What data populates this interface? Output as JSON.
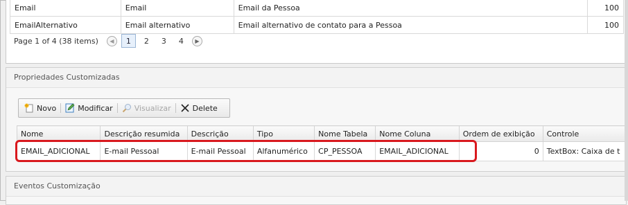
{
  "top_table": {
    "rows": [
      {
        "name": "Email",
        "label": "Email",
        "description": "Email da Pessoa",
        "value": "100"
      },
      {
        "name": "EmailAlternativo",
        "label": "Email alternativo",
        "description": "Email alternativo de contato para a Pessoa",
        "value": "100"
      }
    ]
  },
  "pager": {
    "info": "Page 1 of 4 (38 items)",
    "pages": [
      "1",
      "2",
      "3",
      "4"
    ],
    "current": "1"
  },
  "custom_props": {
    "title": "Propriedades Customizadas",
    "toolbar": {
      "new_label": "Novo",
      "edit_label": "Modificar",
      "view_label": "Visualizar",
      "delete_label": "Delete"
    },
    "columns": [
      "Nome",
      "Descrição resumida",
      "Descrição",
      "Tipo",
      "Nome Tabela",
      "Nome Coluna",
      "Ordem de exibição",
      "Controle"
    ],
    "rows": [
      {
        "nome": "EMAIL_ADICIONAL",
        "desc_resumida": "E-mail Pessoal",
        "descricao": "E-mail Pessoal",
        "tipo": "Alfanumérico",
        "tabela": "CP_PESSOA",
        "coluna": "EMAIL_ADICIONAL",
        "ordem": "0",
        "controle": "TextBox: Caixa de t"
      }
    ]
  },
  "events": {
    "title": "Eventos Customização"
  },
  "colors": {
    "highlight": "#d9191e",
    "pager_active": "#e7f0fb"
  }
}
